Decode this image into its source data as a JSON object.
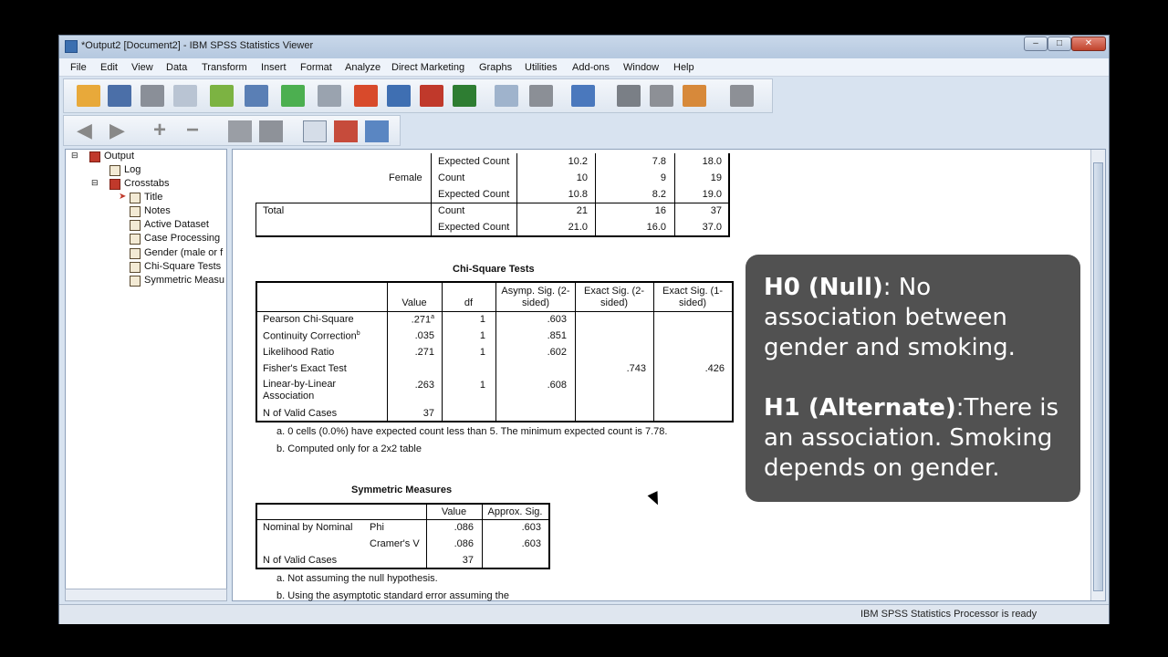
{
  "window": {
    "title": "*Output2 [Document2] - IBM SPSS Statistics Viewer",
    "minimize": "‒",
    "maximize": "□",
    "close": "✕"
  },
  "menu": [
    "File",
    "Edit",
    "View",
    "Data",
    "Transform",
    "Insert",
    "Format",
    "Analyze",
    "Direct Marketing",
    "Graphs",
    "Utilities",
    "Add-ons",
    "Window",
    "Help"
  ],
  "navigation": {
    "items": [
      "Output",
      "Log",
      "Crosstabs",
      "Title",
      "Notes",
      "Active Dataset",
      "Case Processing",
      "Gender (male or f",
      "Chi-Square Tests",
      "Symmetric Measu"
    ]
  },
  "crosstab_fragment": {
    "rows": [
      {
        "group": "",
        "sub": "",
        "stat": "Expected Count",
        "v1": "10.2",
        "v2": "7.8",
        "v3": "18.0"
      },
      {
        "group": "",
        "sub": "Female",
        "stat": "Count",
        "v1": "10",
        "v2": "9",
        "v3": "19"
      },
      {
        "group": "",
        "sub": "",
        "stat": "Expected Count",
        "v1": "10.8",
        "v2": "8.2",
        "v3": "19.0"
      },
      {
        "group": "Total",
        "sub": "",
        "stat": "Count",
        "v1": "21",
        "v2": "16",
        "v3": "37"
      },
      {
        "group": "",
        "sub": "",
        "stat": "Expected Count",
        "v1": "21.0",
        "v2": "16.0",
        "v3": "37.0"
      }
    ]
  },
  "chi_square": {
    "title": "Chi-Square Tests",
    "headers": {
      "value": "Value",
      "df": "df",
      "asymp": "Asymp. Sig. (2-sided)",
      "exact2": "Exact Sig. (2-sided)",
      "exact1": "Exact Sig. (1-sided)"
    },
    "rows": [
      {
        "label": "Pearson Chi-Square",
        "value": ".271",
        "sup": "a",
        "df": "1",
        "asymp": ".603",
        "exact2": "",
        "exact1": ""
      },
      {
        "label": "Continuity Correction",
        "sup_label": "b",
        "value": ".035",
        "df": "1",
        "asymp": ".851",
        "exact2": "",
        "exact1": ""
      },
      {
        "label": "Likelihood Ratio",
        "value": ".271",
        "df": "1",
        "asymp": ".602",
        "exact2": "",
        "exact1": ""
      },
      {
        "label": "Fisher's Exact Test",
        "value": "",
        "df": "",
        "asymp": "",
        "exact2": ".743",
        "exact1": ".426"
      },
      {
        "label": "Linear-by-Linear Association",
        "value": ".263",
        "df": "1",
        "asymp": ".608",
        "exact2": "",
        "exact1": ""
      },
      {
        "label": "N of Valid Cases",
        "value": "37",
        "df": "",
        "asymp": "",
        "exact2": "",
        "exact1": ""
      }
    ],
    "footnote_a": "a. 0 cells (0.0%) have expected count less than 5. The minimum expected count is 7.78.",
    "footnote_b": "b. Computed only for a 2x2 table"
  },
  "symmetric": {
    "title": "Symmetric Measures",
    "headers": {
      "value": "Value",
      "sig": "Approx. Sig."
    },
    "rows": [
      {
        "group": "Nominal by Nominal",
        "measure": "Phi",
        "value": ".086",
        "sig": ".603"
      },
      {
        "group": "",
        "measure": "Cramer's V",
        "value": ".086",
        "sig": ".603"
      },
      {
        "group": "N of Valid Cases",
        "measure": "",
        "value": "37",
        "sig": ""
      }
    ],
    "footnote_a": "a. Not assuming the null hypothesis.",
    "footnote_b": "b. Using the asymptotic standard error assuming the"
  },
  "overlay": {
    "h0_label": "H0 (Null)",
    "h0_text": ": No association between gender and smoking.",
    "h1_label": "H1 (Alternate)",
    "h1_text": ":There is an association.  Smoking depends on gender."
  },
  "status": "IBM SPSS Statistics Processor is ready"
}
